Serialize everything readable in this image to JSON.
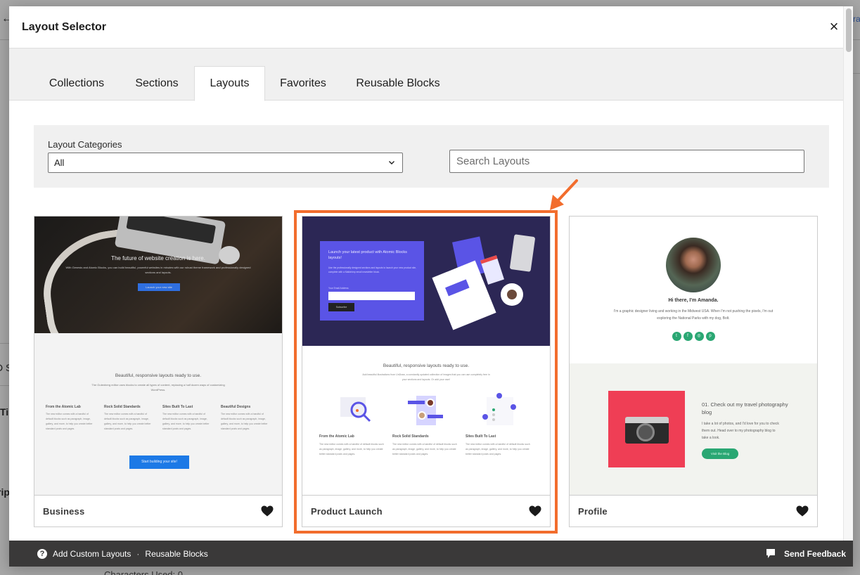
{
  "background": {
    "back_glyph": "←",
    "right_fragment": "ra",
    "left_fragments": [
      "D S",
      "Ti",
      "rip"
    ],
    "bottom_fragment": "Characters Used: 0"
  },
  "modal": {
    "title": "Layout Selector",
    "close_glyph": "×",
    "tabs": [
      {
        "label": "Collections",
        "active": false
      },
      {
        "label": "Sections",
        "active": false
      },
      {
        "label": "Layouts",
        "active": true
      },
      {
        "label": "Favorites",
        "active": false
      },
      {
        "label": "Reusable Blocks",
        "active": false
      }
    ],
    "filters": {
      "category_label": "Layout Categories",
      "category_value": "All",
      "search_placeholder": "Search Layouts",
      "search_value": ""
    },
    "selected_color": "#f26d2d",
    "cards": [
      {
        "name": "Business",
        "favorited": true,
        "selected": false,
        "preview": {
          "hero_title": "The future of website creation is here.",
          "hero_sub": "With Genesis and Atomic Blocks, you can build beautiful, powerful websites in minutes with our robust theme framework and professionally designed sections and layouts.",
          "hero_button": "Launch your new site",
          "heading": "Beautiful, responsive layouts ready to use.",
          "paragraph": "The Gutenberg editor uses blocks to create all types of content, replacing a half dozen ways of customizing WordPress.",
          "columns": [
            {
              "title": "From the Atomic Lab",
              "text": "The new editor comes with a handful of default blocks such as paragraph, image, gallery, and more, to help you create better standard posts and pages."
            },
            {
              "title": "Rock Solid Standards",
              "text": "The new editor comes with a handful of default blocks such as paragraph, image, gallery, and more, to help you create better standard posts and pages."
            },
            {
              "title": "Sites Built To Last",
              "text": "The new editor comes with a handful of default blocks such as paragraph, image, gallery, and more, to help you create better standard posts and pages."
            },
            {
              "title": "Beautiful Designs",
              "text": "The new editor comes with a handful of default blocks such as paragraph, image, gallery, and more, to help you create better standard posts and pages."
            }
          ],
          "cta": "Start building your site!"
        }
      },
      {
        "name": "Product Launch",
        "favorited": true,
        "selected": true,
        "preview": {
          "hero_title": "Launch your latest product with Atomic Blocks layouts!",
          "hero_sub": "Use the professionally designed sections and layouts to launch your new product site, complete with a Mailchimp email newsletter block.",
          "email_label": "Your Email Address",
          "subscribe": "Subscribe",
          "heading": "Beautiful, responsive layouts ready to use.",
          "paragraph": "Add beautiful illustrations from UnDraw, a constantly updated collection of images that you can use completely free in your sections and layouts. Or add your own!",
          "columns": [
            {
              "title": "From the Atomic Lab",
              "text": "The new editor comes with a handful of default blocks such as paragraph, image, gallery, and more, to help you create better standard posts and pages."
            },
            {
              "title": "Rock Solid Standards",
              "text": "The new editor comes with a handful of default blocks such as paragraph, image, gallery, and more, to help you create better standard posts and pages."
            },
            {
              "title": "Sites Built To Last",
              "text": "The new editor comes with a handful of default blocks such as paragraph, image, gallery, and more, to help you create better standard posts and pages."
            }
          ]
        }
      },
      {
        "name": "Profile",
        "favorited": true,
        "selected": false,
        "preview": {
          "heading": "Hi there, I'm Amanda.",
          "paragraph": "I'm a graphic designer living and working in the Midwest USA. When I'm not pushing the pixels, I'm out exploring the National Parks with my dog, Bolt.",
          "socials": [
            "twitter",
            "facebook",
            "dribbble",
            "pinterest"
          ],
          "section_title": "01. Check out my travel photography blog",
          "section_text": "I take a lot of photos, and I'd love for you to check them out. Head over to my photography blog to take a look.",
          "section_button": "Visit the Blog"
        }
      }
    ],
    "footer": {
      "help_glyph": "?",
      "add_custom_layouts": "Add Custom Layouts",
      "separator": "·",
      "reusable_blocks": "Reusable Blocks",
      "send_feedback": "Send Feedback"
    }
  }
}
